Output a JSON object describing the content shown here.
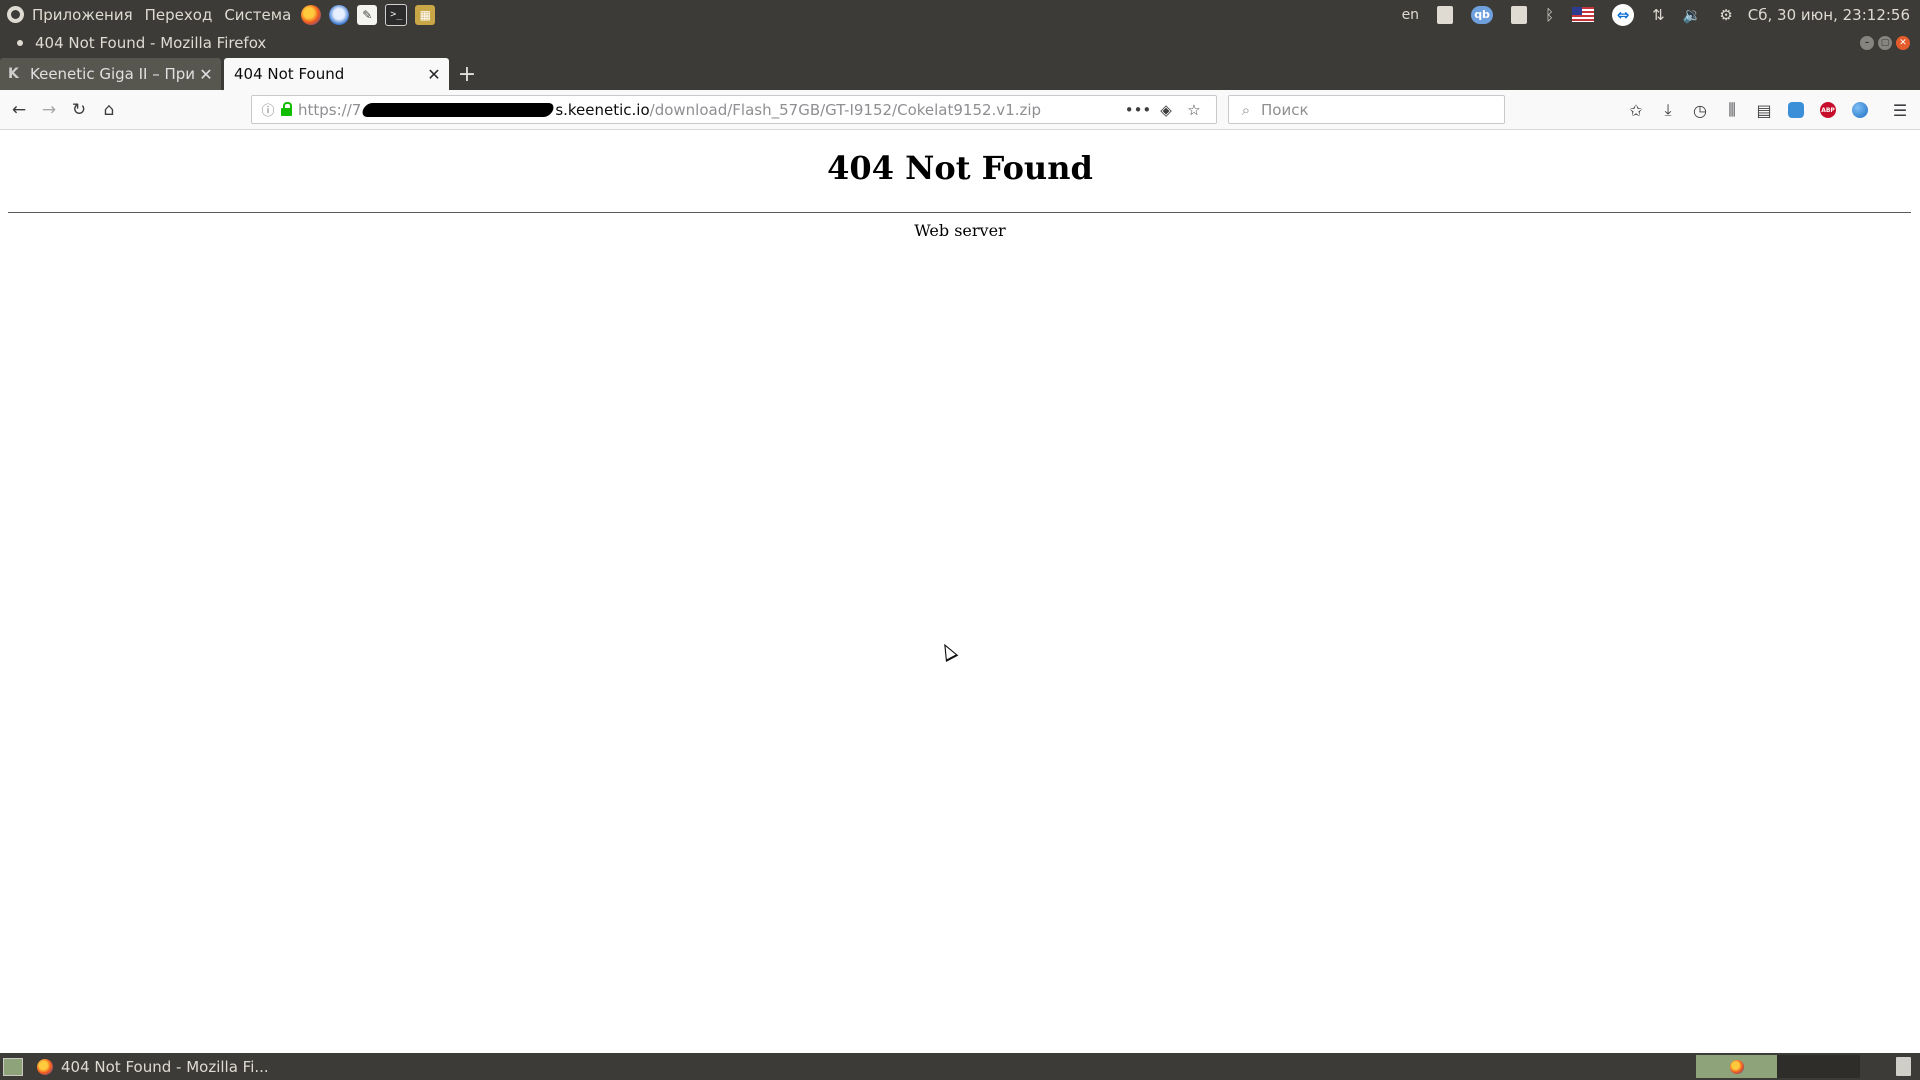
{
  "system_panel": {
    "menus": [
      "Приложения",
      "Переход",
      "Система"
    ],
    "keyboard_layout": "en",
    "qb_label": "qb",
    "clock": "Сб, 30 июн, 23:12:56"
  },
  "window": {
    "title": "404 Not Found - Mozilla Firefox"
  },
  "tabs": [
    {
      "label": "Keenetic Giga II – Прил",
      "favicon": "K",
      "active": false
    },
    {
      "label": "404 Not Found",
      "active": true
    }
  ],
  "navbar": {
    "url_protocol": "https://7",
    "url_host": "s.keenetic.io",
    "url_path": "/download/Flash_57GB/GT-I9152/Cokelat9152.v1.zip",
    "search_placeholder": "Поиск"
  },
  "page": {
    "heading": "404 Not Found",
    "server": "Web server"
  },
  "taskbar": {
    "window_label": "404 Not Found - Mozilla Fi..."
  }
}
